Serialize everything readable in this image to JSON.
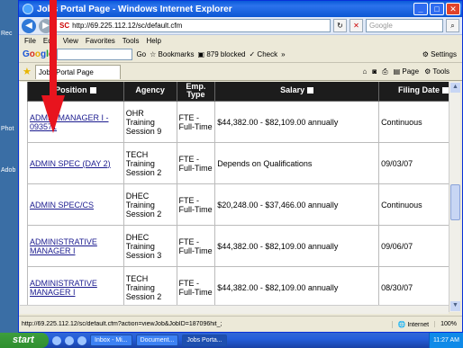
{
  "window": {
    "title": "Jobs Portal Page - Windows Internet Explorer"
  },
  "address": {
    "url": "http://69.225.112.12/sc/default.cfm",
    "search_placeholder": "Google"
  },
  "menu": [
    "File",
    "Edit",
    "View",
    "Favorites",
    "Tools",
    "Help"
  ],
  "googlebar": {
    "go_label": "Go",
    "bookmarks_label": "Bookmarks",
    "blocked_label": "879 blocked",
    "check_label": "Check",
    "more_label": "»",
    "settings_label": "Settings"
  },
  "tab": {
    "label": "Jobs Portal Page",
    "page_label": "Page",
    "tools_label": "Tools"
  },
  "table": {
    "headers": {
      "position": "Position",
      "agency": "Agency",
      "type": "Emp. Type",
      "salary": "Salary",
      "date": "Filing Date"
    },
    "rows": [
      {
        "position": "ADMIN MANAGER I - 093571",
        "agency": "OHR Training Session 9",
        "type": "FTE - Full-Time",
        "salary": "$44,382.00 - $82,109.00 annually",
        "date": "Continuous"
      },
      {
        "position": "ADMIN SPEC (DAY 2)",
        "agency": "TECH Training Session 2",
        "type": "FTE - Full-Time",
        "salary": "Depends on Qualifications",
        "date": "09/03/07"
      },
      {
        "position": "ADMIN SPEC/CS",
        "agency": "DHEC Training Session 2",
        "type": "FTE - Full-Time",
        "salary": "$20,248.00 - $37,466.00 annually",
        "date": "Continuous"
      },
      {
        "position": "ADMINISTRATIVE MANAGER I",
        "agency": "DHEC Training Session 3",
        "type": "FTE - Full-Time",
        "salary": "$44,382.00 - $82,109.00 annually",
        "date": "09/06/07"
      },
      {
        "position": "ADMINISTRATIVE MANAGER I",
        "agency": "TECH Training Session 2",
        "type": "FTE - Full-Time",
        "salary": "$44,382.00 - $82,109.00 annually",
        "date": "08/30/07"
      }
    ]
  },
  "status": {
    "url": "http://69.225.112.12/sc/default.cfm?action=viewJob&JobID=187096hit_;",
    "zone": "Internet",
    "zoom": "100%"
  },
  "taskbar": {
    "start_label": "start",
    "tasks": [
      "Inbox - Mi...",
      "Document...",
      "Jobs Porta..."
    ],
    "clock": "11:27 AM"
  },
  "desktop": {
    "labels": [
      "Rec",
      "Phot",
      "Adob"
    ]
  },
  "colors": {
    "annotation": "#e8141e",
    "header_bg": "#1c1c1c",
    "link": "#1b1b8f"
  }
}
